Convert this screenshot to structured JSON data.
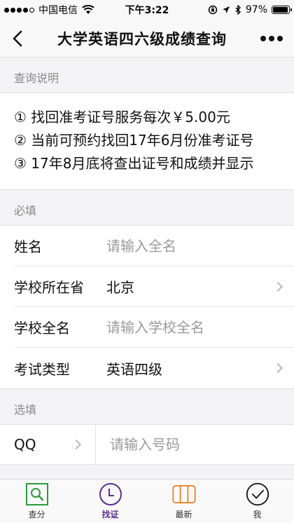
{
  "status": {
    "carrier": "中国电信",
    "time": "下午3:22",
    "battery": "97%",
    "battery_level": 0.97
  },
  "nav": {
    "title": "大学英语四六级成绩查询"
  },
  "notice": {
    "header": "查询说明",
    "lines": [
      "① 找回准考证号服务每次￥5.00元",
      "② 当前可预约找回17年6月份准考证号",
      "③ 17年8月底将查出证号和成绩并显示"
    ]
  },
  "required": {
    "header": "必填",
    "name": {
      "label": "姓名",
      "placeholder": "请输入全名"
    },
    "province": {
      "label": "学校所在省",
      "value": "北京"
    },
    "school": {
      "label": "学校全名",
      "placeholder": "请输入学校全名"
    },
    "exam_type": {
      "label": "考试类型",
      "value": "英语四级"
    }
  },
  "optional": {
    "header": "选填",
    "qq": {
      "label": "QQ",
      "placeholder": "请输入号码"
    }
  },
  "tabs": [
    {
      "label": "查分",
      "icon": "search-icon",
      "color": "#2e9a3c"
    },
    {
      "label": "找证",
      "icon": "clock-icon",
      "color": "#5a2d8c"
    },
    {
      "label": "最新",
      "icon": "columns-icon",
      "color": "#e6822e"
    },
    {
      "label": "我",
      "icon": "check-circle-icon",
      "color": "#111111"
    }
  ]
}
